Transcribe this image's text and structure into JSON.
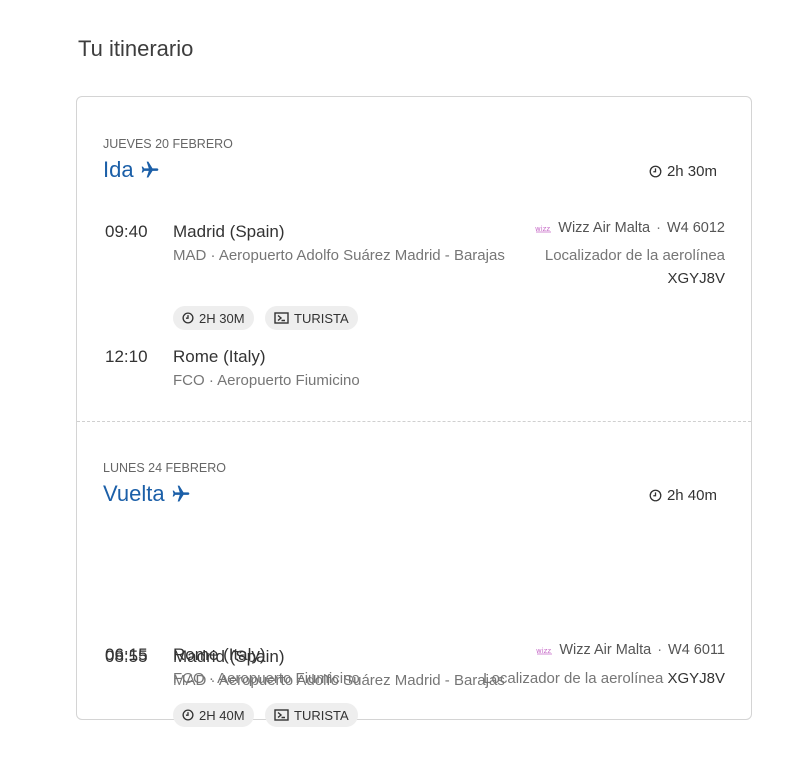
{
  "page_title": "Tu itinerario",
  "outbound": {
    "date": "JUEVES 20 FEBRERO",
    "title": "Ida",
    "duration": "2h 30m",
    "departure": {
      "time": "09:40",
      "city": "Madrid (Spain)",
      "airport": "MAD · Aeropuerto Adolfo Suárez Madrid - Barajas"
    },
    "airline": "Wizz Air Malta",
    "flight_number": "W4 6012",
    "locator_label": "Localizador de la aerolínea",
    "locator_code": "XGYJ8V",
    "tags": {
      "duration": "2H 30M",
      "cabin": "TURISTA"
    },
    "arrival": {
      "time": "12:10",
      "city": "Rome (Italy)",
      "airport": "FCO · Aeropuerto Fiumicino"
    }
  },
  "return": {
    "date": "LUNES 24 FEBRERO",
    "title": "Vuelta",
    "duration": "2h 40m",
    "departure": {
      "time": "06:15",
      "city": "Rome (Italy)",
      "airport": "FCO · Aeropuerto Fiumicino"
    },
    "airline": "Wizz Air Malta",
    "flight_number": "W4 6011",
    "locator_label": "Localizador de la aerolínea",
    "locator_code": "XGYJ8V",
    "tags": {
      "duration": "2H 40M",
      "cabin": "TURISTA"
    },
    "arrival": {
      "time": "08:55",
      "city": "Madrid (Spain)",
      "airport": "MAD · Aeropuerto Adolfo Suárez Madrid - Barajas"
    }
  },
  "colors": {
    "accent": "#1b5fa8",
    "pill_bg": "#eeeeee",
    "airline_logo": "#c86fc9"
  },
  "icons": [
    "plane-icon",
    "clock-icon",
    "seat-icon",
    "airline-logo-icon"
  ]
}
